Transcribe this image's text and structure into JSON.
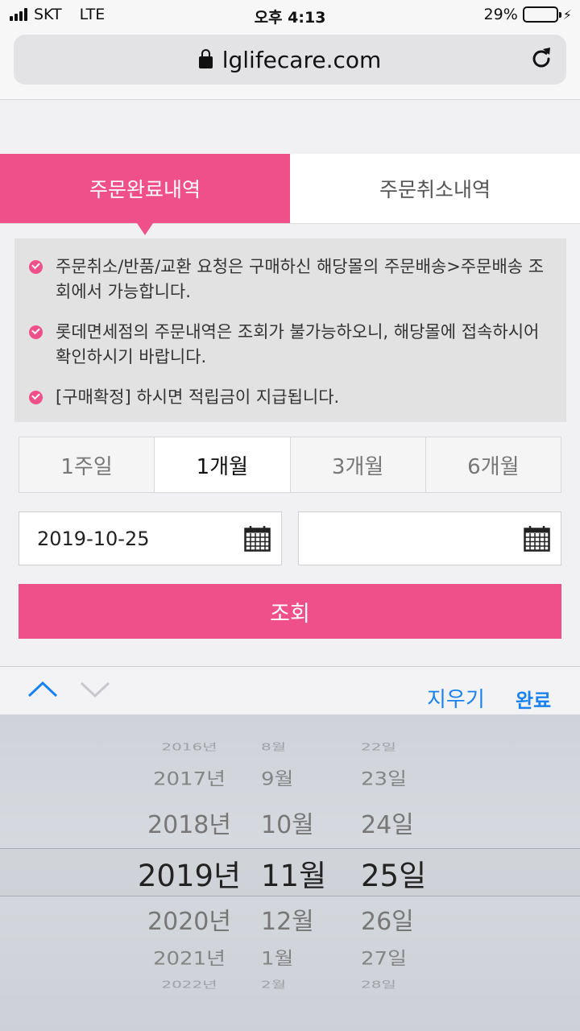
{
  "status_bar": {
    "carrier": "SKT",
    "network": "LTE",
    "time": "오후 4:13",
    "battery": "29%",
    "battery_level": 0.29
  },
  "browser": {
    "url": "lglifecare.com"
  },
  "tabs": [
    {
      "label": "주문완료내역",
      "active": true
    },
    {
      "label": "주문취소내역",
      "active": false
    }
  ],
  "notices": [
    "주문취소/반품/교환 요청은 구매하신 해당몰의 주문배송>주문배송 조회에서 가능합니다.",
    "롯데면세점의 주문내역은 조회가 불가능하오니, 해당몰에 접속하시어 확인하시기 바랍니다.",
    "[구매확정] 하시면 적립금이 지급됩니다."
  ],
  "periods": [
    {
      "label": "1주일",
      "active": false
    },
    {
      "label": "1개월",
      "active": true
    },
    {
      "label": "3개월",
      "active": false
    },
    {
      "label": "6개월",
      "active": false
    }
  ],
  "date_from": "2019-10-25",
  "date_to": "",
  "search_label": "조회",
  "keyboard_toolbar": {
    "clear_label": "지우기",
    "done_label": "완료"
  },
  "picker": {
    "years": [
      "2016년",
      "2017년",
      "2018년",
      "2019년",
      "2020년",
      "2021년",
      "2022년"
    ],
    "months": [
      "8월",
      "9월",
      "10월",
      "11월",
      "12월",
      "1월",
      "2월"
    ],
    "days": [
      "22일",
      "23일",
      "24일",
      "25일",
      "26일",
      "27일",
      "28일"
    ],
    "selected_index": 3
  },
  "colors": {
    "accent": "#f0508a",
    "ios_blue": "#1a82f0"
  }
}
